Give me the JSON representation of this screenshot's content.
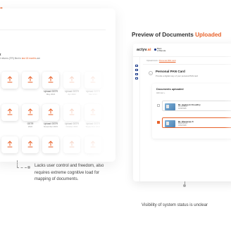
{
  "left": {
    "subtitle": "t",
    "description_prefix": "t returns (ITR) filed in",
    "description_link": "last 18 months",
    "description_suffix": "are",
    "tiles": [
      {
        "label": "",
        "sub": ""
      },
      {
        "label": "",
        "sub": ""
      },
      {
        "label": "Upload GSTR",
        "sub": "May 2022"
      },
      {
        "label": "Upload GSTR",
        "sub": "Apr 2022"
      },
      {
        "label": "Upload GSTR",
        "sub": "Mar 2022"
      },
      {
        "label": "",
        "sub": ""
      },
      {
        "label": "GSTR",
        "sub": "2022"
      },
      {
        "label": "Upload GSTR",
        "sub": "November 2021"
      },
      {
        "label": "Upload GSTR",
        "sub": "October 2021"
      },
      {
        "label": "Upload GSTR",
        "sub": "September 2021"
      },
      {
        "label": "",
        "sub": ""
      },
      {
        "label": "",
        "sub": ""
      },
      {
        "label": "",
        "sub": ""
      },
      {
        "label": "",
        "sub": ""
      },
      {
        "label": "",
        "sub": ""
      }
    ],
    "caption": "Lacks user control and freedom, also requires extreme cognitive load for mapping of documents."
  },
  "right": {
    "title_prefix": "Preview of Documents",
    "title_highlight": "Uploaded",
    "logo_text": "actyv",
    "logo_suffix": ".ai",
    "partner_line1": "Bank",
    "partner_line2": "of Baroda",
    "breadcrumb_root": "Upload docs",
    "breadcrumb_sep": "/",
    "breadcrumb_active": "Personal PAN card",
    "card_title": "Personal PAN Card",
    "card_description": "Provide a digital copy of your personal PAN card",
    "docs_title": "Documents uploaded",
    "docs_count": "Add new +",
    "documents": [
      {
        "name": "Mr. Jagdeesh Choudhry",
        "meta1": "ACVPK5631",
        "meta2": "12/08/1995",
        "selected": false
      },
      {
        "name": "Mr. Dhananjay K",
        "meta1": "BQRPS4102",
        "meta2": "14/02/1998",
        "selected": true
      }
    ],
    "caption": "Visibility of system status is unclear"
  },
  "colors": {
    "accent": "#e8622a",
    "brand": "#1b3a8a"
  },
  "icons": {
    "upload": "upload-arrow-icon",
    "back": "back-arrow-icon"
  }
}
